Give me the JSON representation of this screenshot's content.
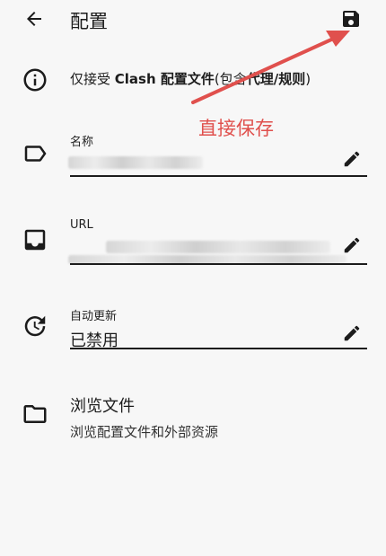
{
  "appbar": {
    "title": "配置",
    "back_icon": "arrow-back-icon",
    "save_icon": "save-icon"
  },
  "hint": {
    "prefix": "仅接受 ",
    "bold1": "Clash 配置文件",
    "middle": "(包含",
    "bold2": "代理/规则",
    "suffix": ")"
  },
  "annotation": {
    "text": "直接保存",
    "color": "#e0504d"
  },
  "fields": {
    "name": {
      "label": "名称",
      "value": ""
    },
    "url": {
      "label": "URL",
      "value": ""
    },
    "auto_update": {
      "label": "自动更新",
      "value": "已禁用"
    }
  },
  "browse": {
    "title": "浏览文件",
    "subtitle": "浏览配置文件和外部资源"
  }
}
